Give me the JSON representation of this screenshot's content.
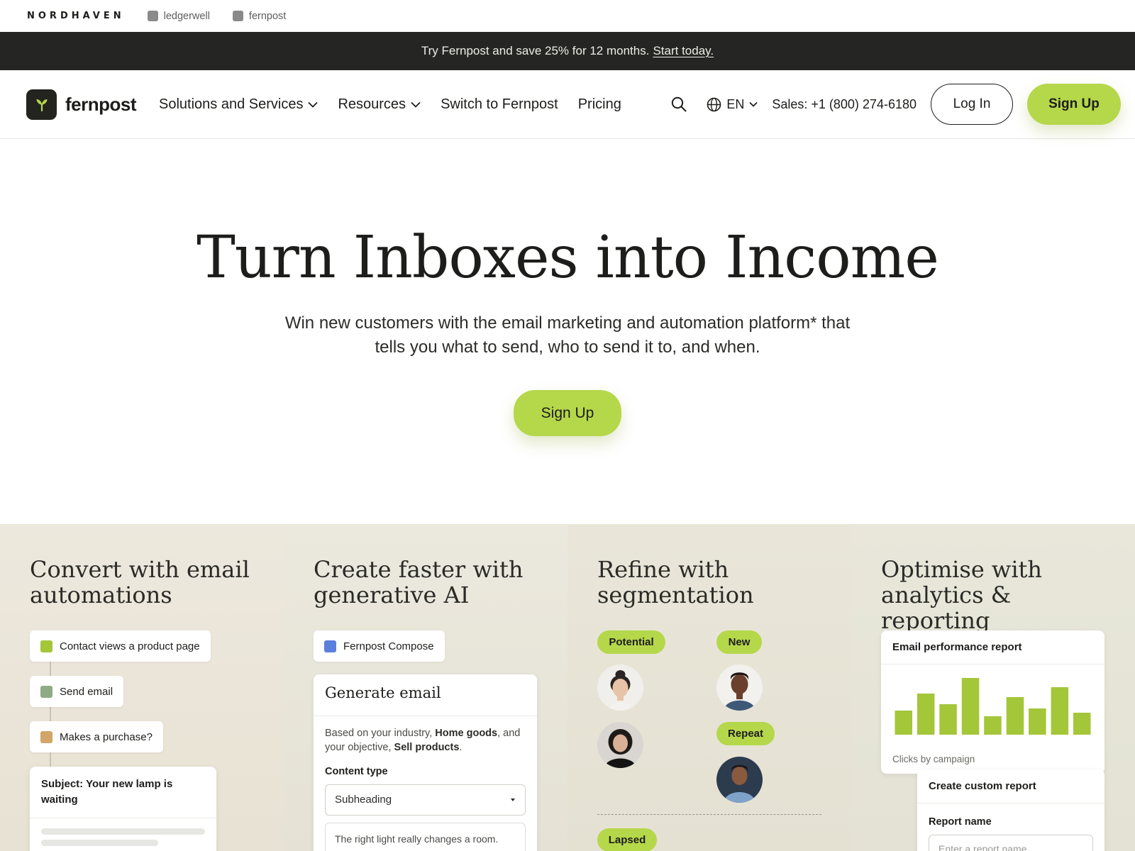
{
  "brandbar": {
    "logo": "NORDHAVEN",
    "sites": [
      {
        "label": "ledgerwell"
      },
      {
        "label": "fernpost"
      }
    ]
  },
  "promo": {
    "text": "Try Fernpost and save 25% for 12 months.",
    "link": "Start today."
  },
  "nav": {
    "brand": "fernpost",
    "items": [
      {
        "label": "Solutions and Services",
        "has_dropdown": true
      },
      {
        "label": "Resources",
        "has_dropdown": true
      },
      {
        "label": "Switch to Fernpost",
        "has_dropdown": false
      },
      {
        "label": "Pricing",
        "has_dropdown": false
      }
    ],
    "search_icon": "search-icon",
    "language": "EN",
    "sales": "Sales: +1 (800) 274-6180",
    "login": "Log In",
    "signup": "Sign Up"
  },
  "hero": {
    "title": "Turn Inboxes into Income",
    "subtitle": "Win new customers with the email marketing and automation platform* that tells you what to send, who to send it to, and when.",
    "cta": "Sign Up"
  },
  "features": {
    "automations": {
      "title": "Convert with email automations",
      "steps": [
        {
          "label": "Contact views a product page",
          "color": "#a4c639"
        },
        {
          "label": "Send email",
          "color": "#8fab84"
        },
        {
          "label": "Makes a purchase?",
          "color": "#d2a568"
        }
      ],
      "subject": "Subject: Your new lamp is waiting"
    },
    "ai": {
      "title": "Create faster with generative AI",
      "chip": "Fernpost Compose",
      "chip_color": "#5b7fdc",
      "card_title": "Generate email",
      "desc_1": "Based on your industry,",
      "desc_industry": "Home goods",
      "desc_2": "and your objective,",
      "desc_objective": "Sell products",
      "content_type_label": "Content type",
      "content_type_value": "Subheading",
      "textarea_text": "The right light really changes a room."
    },
    "segmentation": {
      "title": "Refine with segmentation",
      "badges": {
        "potential": "Potential",
        "new": "New",
        "repeat": "Repeat",
        "lapsed": "Lapsed"
      }
    },
    "analytics": {
      "title": "Optimise with analytics & reporting",
      "report_title": "Email performance report",
      "caption": "Clicks by campaign",
      "custom_title": "Create custom report",
      "report_name_label": "Report name",
      "report_name_placeholder": "Enter a report name"
    }
  },
  "chart_data": {
    "type": "bar",
    "title": "Email performance report",
    "xlabel": "Clicks by campaign",
    "ylabel": "",
    "values": [
      34,
      58,
      43,
      80,
      26,
      53,
      37,
      67,
      31
    ],
    "ylim": [
      0,
      85
    ],
    "color": "#a4c639"
  },
  "colors": {
    "accent": "#b5d74a",
    "dark": "#252623"
  }
}
